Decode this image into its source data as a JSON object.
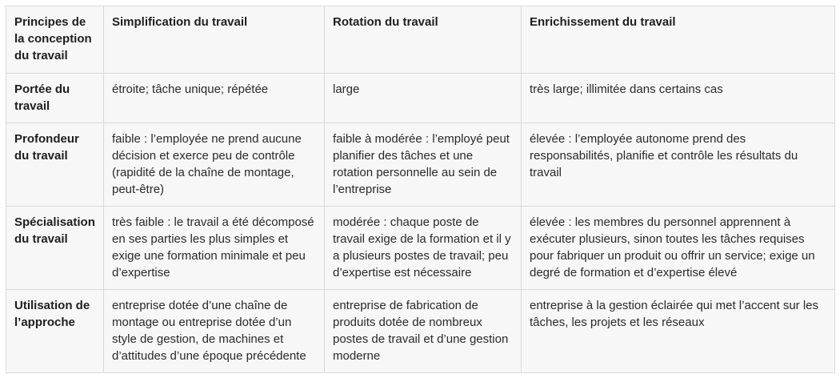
{
  "table": {
    "headers": [
      "Principes de la conception du travail",
      "Simplification du travail",
      "Rotation du travail",
      "Enrichissement du travail"
    ],
    "rows": [
      [
        "Portée du travail",
        "étroite; tâche unique; répétée",
        "large",
        "très large; illimitée dans certains cas"
      ],
      [
        "Profondeur du travail",
        "faible : l’employée ne prend aucune décision et exerce peu de contrôle (rapidité de la chaîne de montage, peut-être)",
        "faible à modérée : l’employé peut planifier des tâches et une rotation personnelle au sein de l’entreprise",
        "élevée : l’employée autonome prend des responsabilités, planifie et contrôle les résultats du travail"
      ],
      [
        "Spécialisation du travail",
        "très faible : le travail a été décomposé en ses parties les plus simples et exige une formation minimale et peu d’expertise",
        "modérée : chaque poste de travail exige de la formation et il y a plusieurs postes de travail; peu d’expertise est nécessaire",
        "élevée : les membres du personnel apprennent à exécuter plusieurs, sinon toutes les tâches requises pour fabriquer un produit ou offrir un service; exige un degré de formation et d’expertise élevé"
      ],
      [
        "Utilisation de l’approche",
        "entreprise dotée d’une chaîne de montage ou entreprise dotée d’un style de gestion, de machines et d’attitudes d’une époque précédente",
        "entreprise de fabrication de produits dotée de nombreux postes de travail et d’une gestion moderne",
        "entreprise à la gestion éclairée qui met l’accent sur les tâches, les projets et les réseaux"
      ]
    ]
  }
}
